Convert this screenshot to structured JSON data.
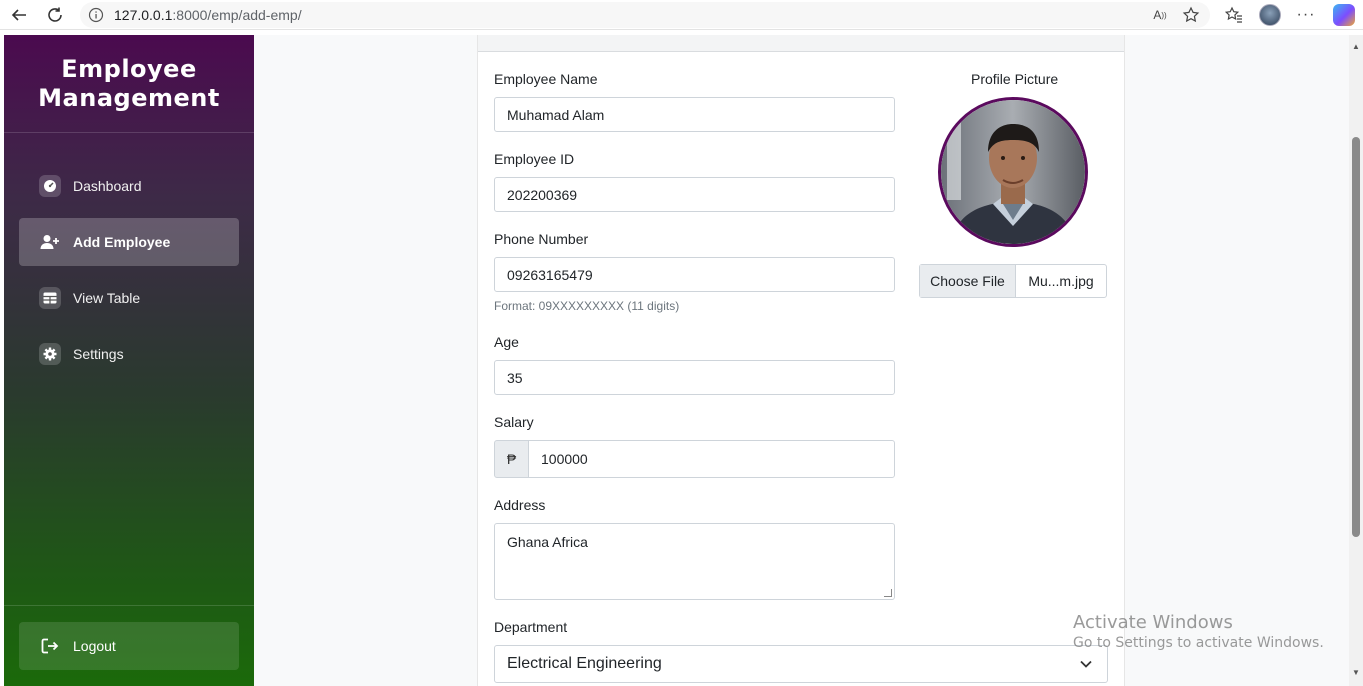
{
  "browser": {
    "url_host": "127.0.0.1",
    "url_path": ":8000/emp/add-emp/"
  },
  "sidebar": {
    "brand_line1": "Employee",
    "brand_line2": "Management",
    "items": [
      {
        "label": "Dashboard",
        "icon": "dashboard-icon",
        "active": false
      },
      {
        "label": "Add Employee",
        "icon": "user-plus-icon",
        "active": true
      },
      {
        "label": "View Table",
        "icon": "table-icon",
        "active": false
      },
      {
        "label": "Settings",
        "icon": "gear-icon",
        "active": false
      }
    ],
    "logout_label": "Logout"
  },
  "form": {
    "employee_name": {
      "label": "Employee Name",
      "value": "Muhamad Alam"
    },
    "employee_id": {
      "label": "Employee ID",
      "value": "202200369"
    },
    "phone": {
      "label": "Phone Number",
      "value": "09263165479",
      "help": "Format: 09XXXXXXXXX (11 digits)"
    },
    "age": {
      "label": "Age",
      "value": "35"
    },
    "salary": {
      "label": "Salary",
      "currency": "₱",
      "value": "100000"
    },
    "address": {
      "label": "Address",
      "value": "Ghana Africa"
    },
    "department": {
      "label": "Department",
      "value": "Electrical Engineering"
    },
    "profile": {
      "label": "Profile Picture",
      "choose_file": "Choose File",
      "file_name": "Mu...m.jpg"
    }
  },
  "watermark": {
    "line1": "Activate Windows",
    "line2": "Go to Settings to activate Windows."
  },
  "colors": {
    "sidebar_top": "#4b0a4f",
    "sidebar_bottom": "#1b6a0a",
    "photo_border": "#5b0a5e"
  }
}
